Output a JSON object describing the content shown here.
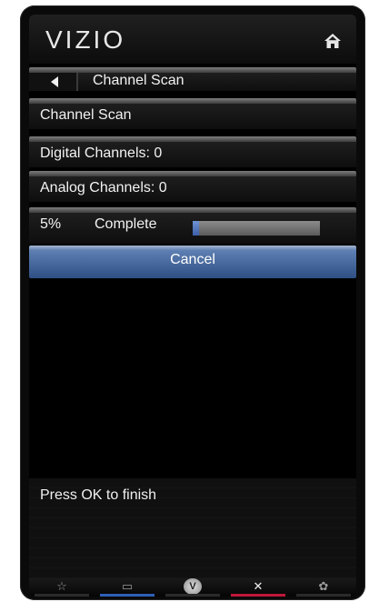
{
  "brand": {
    "logo_text": "VIZIO",
    "home_icon": "home-icon"
  },
  "title_row": {
    "back_icon": "back-arrow-icon",
    "title": "Channel Scan"
  },
  "rows": {
    "channel_scan": "Channel Scan",
    "digital": "Digital Channels: 0",
    "analog": "Analog Channels: 0"
  },
  "progress": {
    "percent_text": "5%",
    "status_text": "Complete",
    "fraction": 0.05
  },
  "cancel_label": "Cancel",
  "hint_text": "Press OK to finish",
  "nav": [
    {
      "icon": "star-icon",
      "glyph": "☆",
      "underline": "#2a2a2a"
    },
    {
      "icon": "widget-icon",
      "glyph": "▭",
      "underline": "#2d5fb5"
    },
    {
      "icon": "vizio-v-icon",
      "glyph": "V",
      "underline": "#2a2a2a"
    },
    {
      "icon": "close-icon",
      "glyph": "✕",
      "underline": "#c0163a"
    },
    {
      "icon": "gear-icon",
      "glyph": "✿",
      "underline": "#2a2a2a"
    }
  ],
  "colors": {
    "accent_blue": "#2f4f84",
    "progress_blue": "#3c5fa8",
    "red": "#c0163a"
  }
}
